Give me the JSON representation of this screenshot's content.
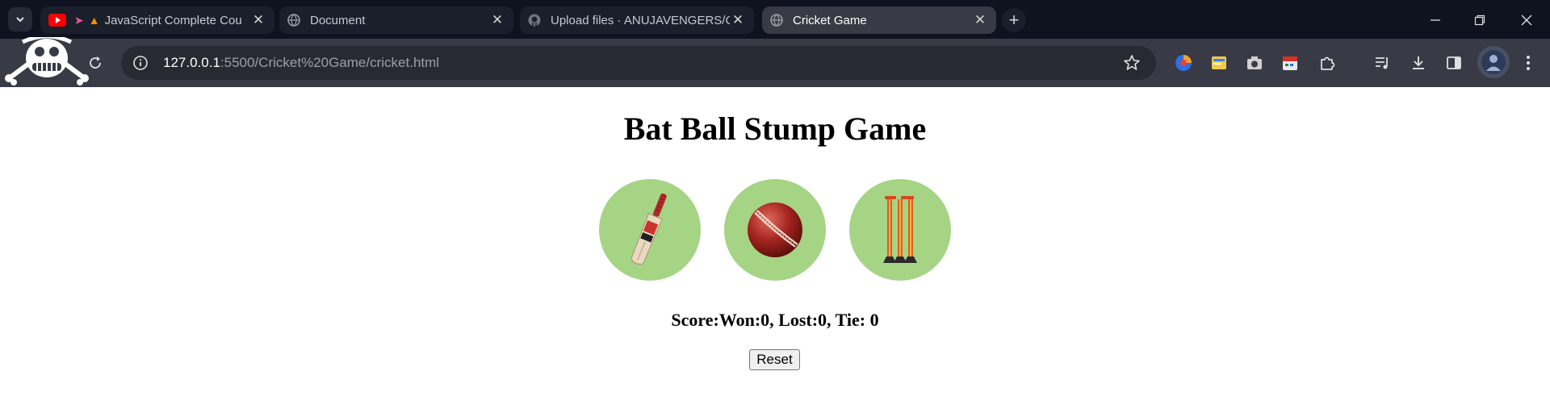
{
  "tabs": [
    {
      "title": "JavaScript Complete Cou",
      "active": false
    },
    {
      "title": "Document",
      "active": false
    },
    {
      "title": "Upload files · ANUJAVENGERS/C",
      "active": false
    },
    {
      "title": "Cricket Game",
      "active": true
    }
  ],
  "address_bar": {
    "host": "127.0.0.1",
    "path": ":5500/Cricket%20Game/cricket.html"
  },
  "page": {
    "title": "Bat Ball Stump Game",
    "choices": [
      {
        "name": "Bat",
        "icon": "cricket-bat-icon"
      },
      {
        "name": "Ball",
        "icon": "cricket-ball-icon"
      },
      {
        "name": "Stump",
        "icon": "stumps-icon"
      }
    ],
    "score_text": "Score:Won:0, Lost:0, Tie: 0",
    "reset_label": "Reset"
  },
  "colors": {
    "choice_bg": "#a6d485",
    "chrome_dark": "#0f1320",
    "toolbar": "#383b45"
  }
}
